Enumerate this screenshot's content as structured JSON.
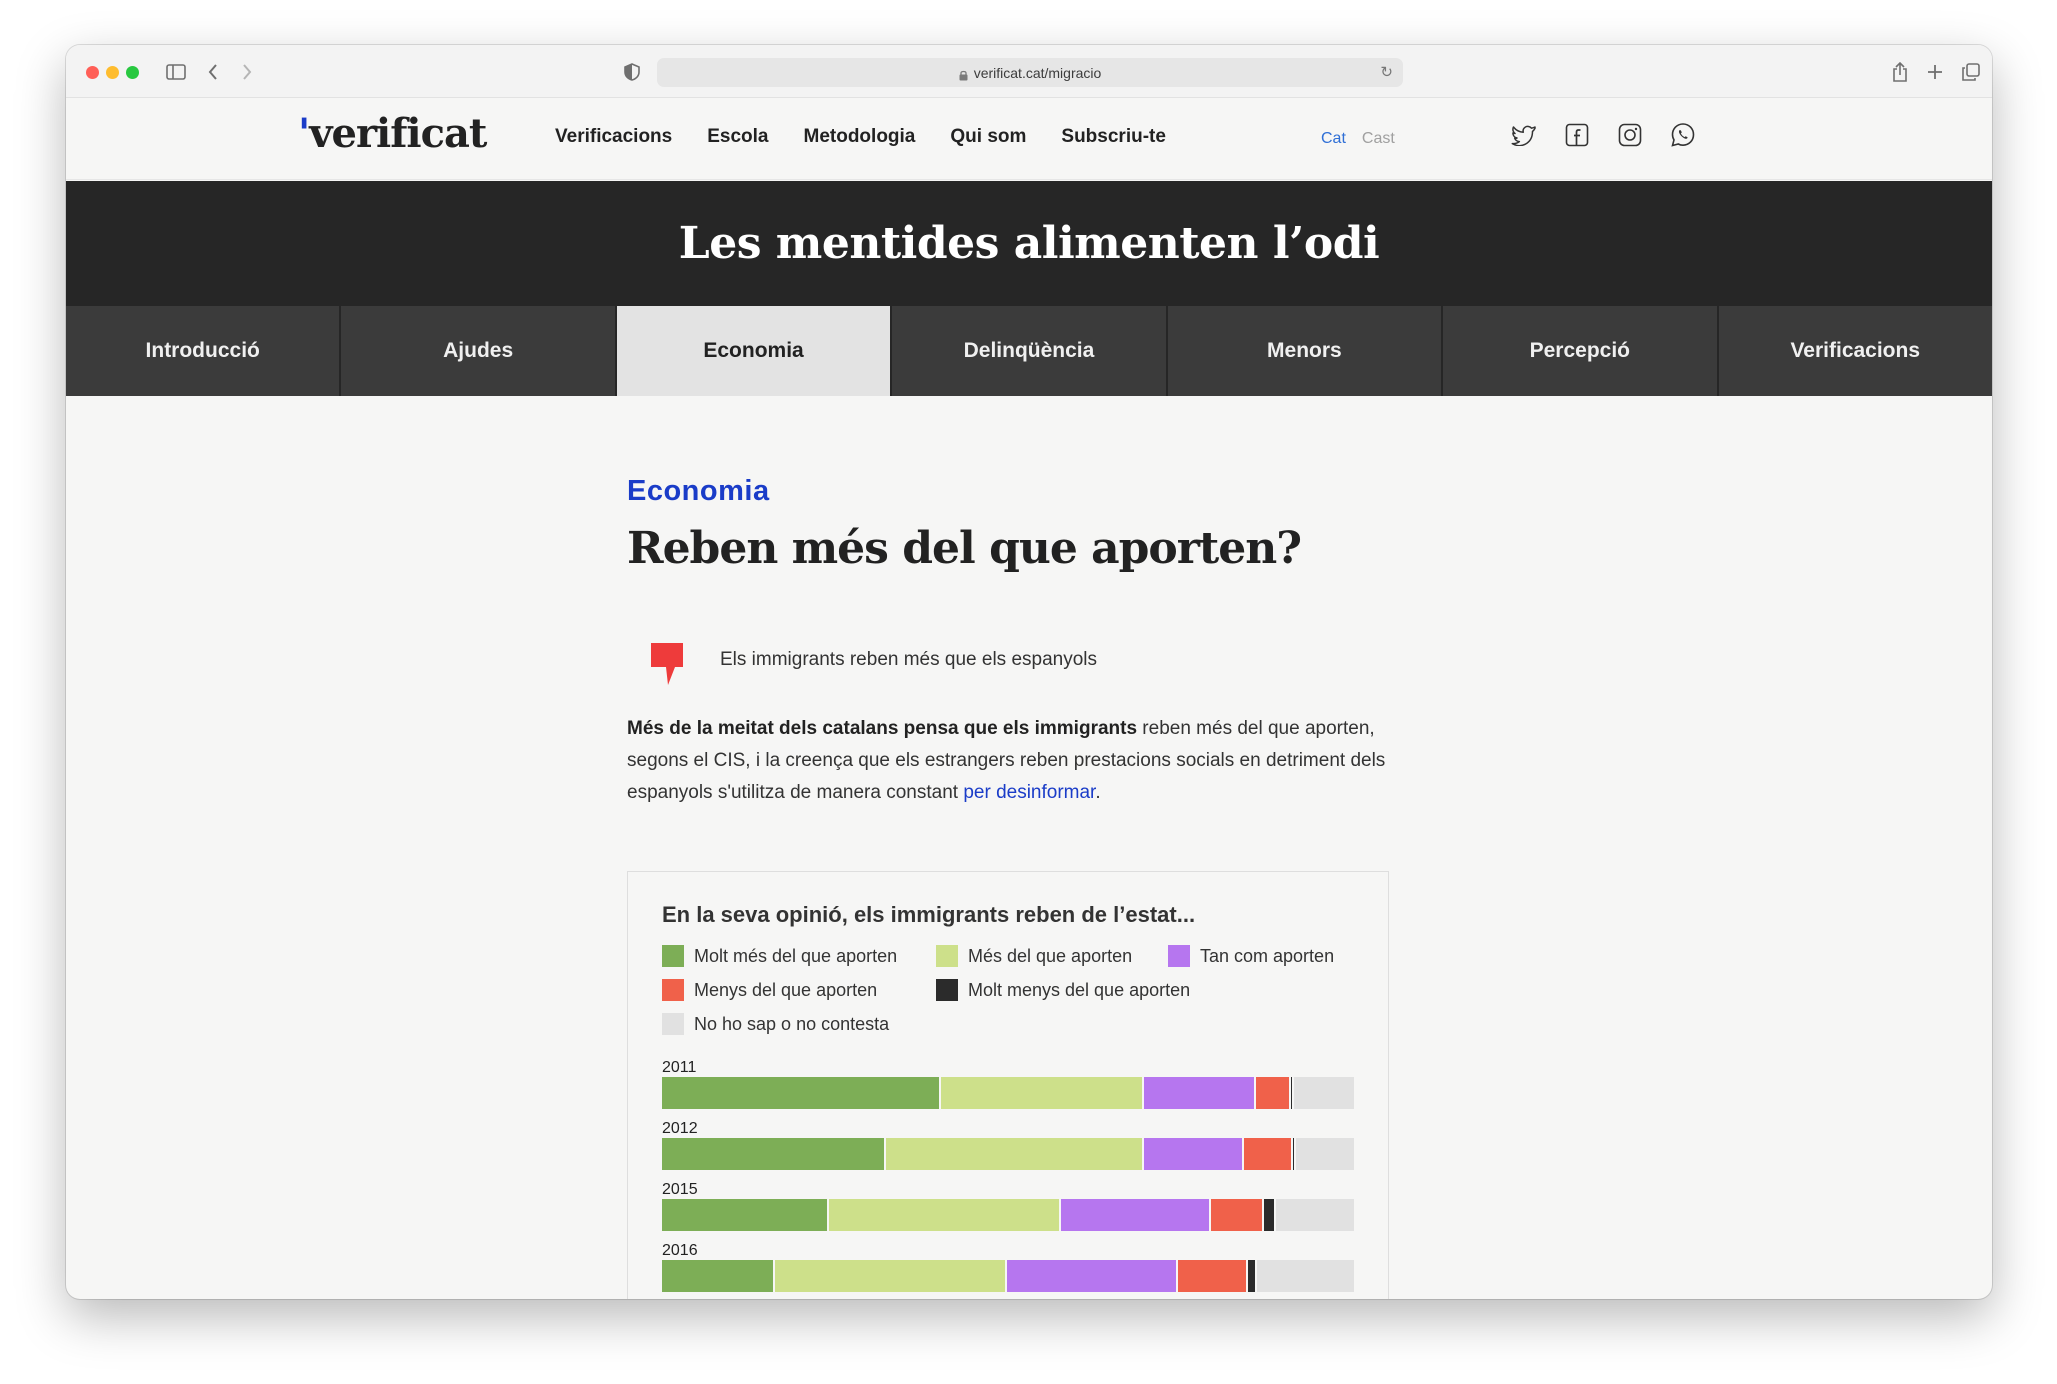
{
  "browser": {
    "url": "verificat.cat/migracio"
  },
  "site": {
    "logo_main": "erificat",
    "logo_v": "v",
    "nav": [
      "Verificacions",
      "Escola",
      "Metodologia",
      "Qui som",
      "Subscriu-te"
    ],
    "lang_active": "Cat",
    "lang_other": "Cast",
    "social_icons": [
      "twitter-icon",
      "facebook-icon",
      "instagram-icon",
      "whatsapp-icon"
    ]
  },
  "banner": {
    "title": "Les mentides alimenten l’odi"
  },
  "tabs": [
    {
      "label": "Introducció",
      "active": false
    },
    {
      "label": "Ajudes",
      "active": false
    },
    {
      "label": "Economia",
      "active": true
    },
    {
      "label": "Delinqüència",
      "active": false
    },
    {
      "label": "Menors",
      "active": false
    },
    {
      "label": "Percepció",
      "active": false
    },
    {
      "label": "Verificacions",
      "active": false
    }
  ],
  "article": {
    "kicker": "Economia",
    "headline": "Reben més del que aporten?",
    "claim": "Els immigrants reben més que els espanyols",
    "para_bold": "Més de la meitat dels catalans pensa que els immigrants",
    "para_rest": " reben més del que aporten, segons el CIS, i la creença que els estrangers reben prestacions socials en detriment dels espanyols s'utilitza de manera constant ",
    "para_link": "per desinformar",
    "para_end": "."
  },
  "colors": {
    "accent": "#1a3cc8",
    "claim_red": "#ee3b3b"
  },
  "chart_data": {
    "type": "bar",
    "orientation": "horizontal-stacked-100",
    "title": "En la seva opinió, els immigrants reben de l’estat...",
    "legend": [
      {
        "name": "Molt més del que aporten",
        "color": "#7dae56"
      },
      {
        "name": "Més del que aporten",
        "color": "#cde08a"
      },
      {
        "name": "Tan com aporten",
        "color": "#b676ef"
      },
      {
        "name": "Menys del que aporten",
        "color": "#f0614a"
      },
      {
        "name": "Molt menys del que aporten",
        "color": "#2b2b2b"
      },
      {
        "name": "No ho sap o no contesta",
        "color": "#e1e1e1"
      }
    ],
    "categories": [
      "2011",
      "2012",
      "2015",
      "2016"
    ],
    "series": [
      {
        "name": "Molt més del que aporten",
        "values": [
          40.3,
          32.4,
          24.2,
          16.4
        ]
      },
      {
        "name": "Més del que aporten",
        "values": [
          29.3,
          37.3,
          33.5,
          33.5
        ]
      },
      {
        "name": "Tan com aporten",
        "values": [
          16.3,
          14.4,
          21.7,
          24.7
        ]
      },
      {
        "name": "Menys del que aporten",
        "values": [
          5.0,
          7.1,
          7.6,
          10.1
        ]
      },
      {
        "name": "Molt menys del que aporten",
        "values": [
          0.5,
          0.4,
          1.7,
          1.3
        ]
      },
      {
        "name": "No ho sap o no contesta",
        "values": [
          8.6,
          8.4,
          11.3,
          14.0
        ]
      }
    ]
  }
}
